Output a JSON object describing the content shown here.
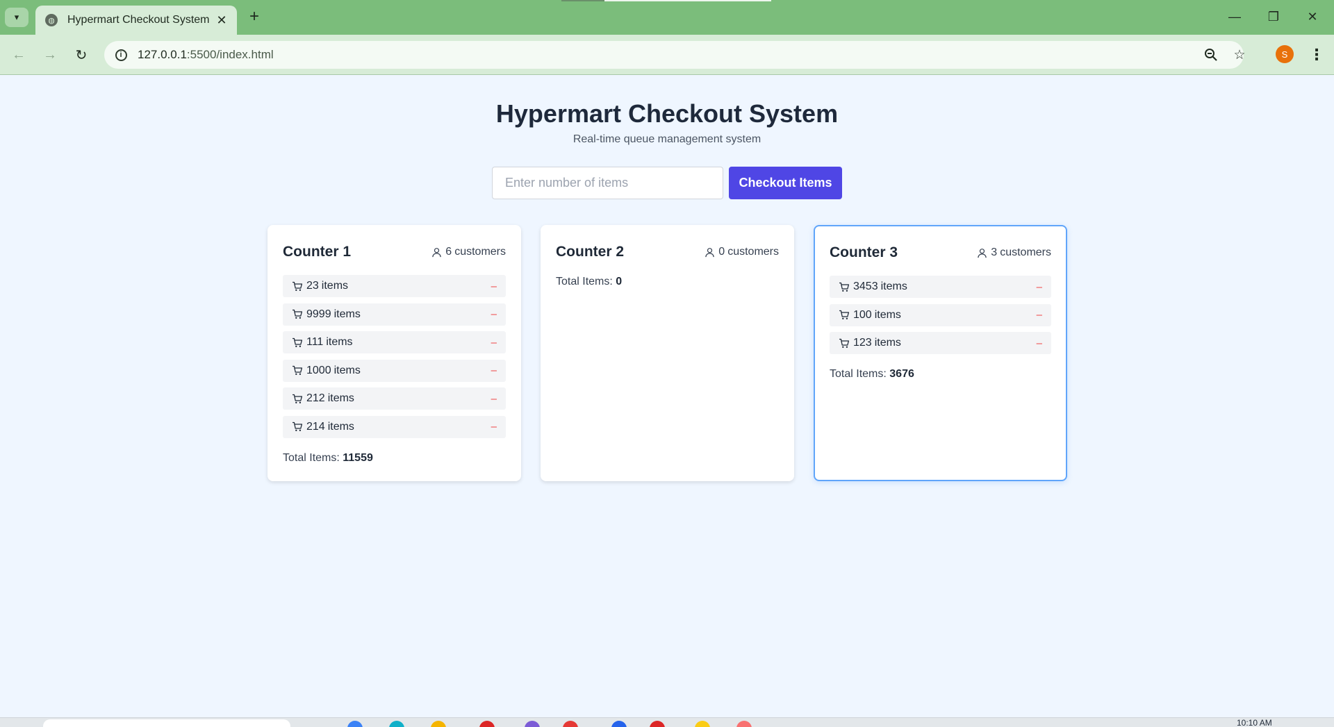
{
  "browser": {
    "tab_title": "Hypermart Checkout System",
    "url_host": "127.0.0.1",
    "url_path": ":5500/index.html",
    "profile_initial": "S"
  },
  "app": {
    "title": "Hypermart Checkout System",
    "subtitle": "Real-time queue management system",
    "input_placeholder": "Enter number of items",
    "checkout_label": "Checkout Items",
    "items_suffix": "items",
    "customers_suffix": "customers",
    "total_label": "Total Items:",
    "remove_glyph": "–"
  },
  "counters": [
    {
      "name": "Counter 1",
      "customers": "6",
      "queue": [
        "23",
        "9999",
        "111",
        "1000",
        "212",
        "214"
      ],
      "total": "11559",
      "active": false
    },
    {
      "name": "Counter 2",
      "customers": "0",
      "queue": [],
      "total": "0",
      "active": false
    },
    {
      "name": "Counter 3",
      "customers": "3",
      "queue": [
        "3453",
        "100",
        "123"
      ],
      "total": "3676",
      "active": true
    }
  ],
  "taskbar": {
    "clock": "10:10 AM"
  },
  "colors": {
    "accent": "#4f46e5",
    "active_border": "#60a5fa",
    "remove": "#ef4444",
    "page_bg": "#eff6ff",
    "chrome_frame": "#7bbd7b"
  }
}
